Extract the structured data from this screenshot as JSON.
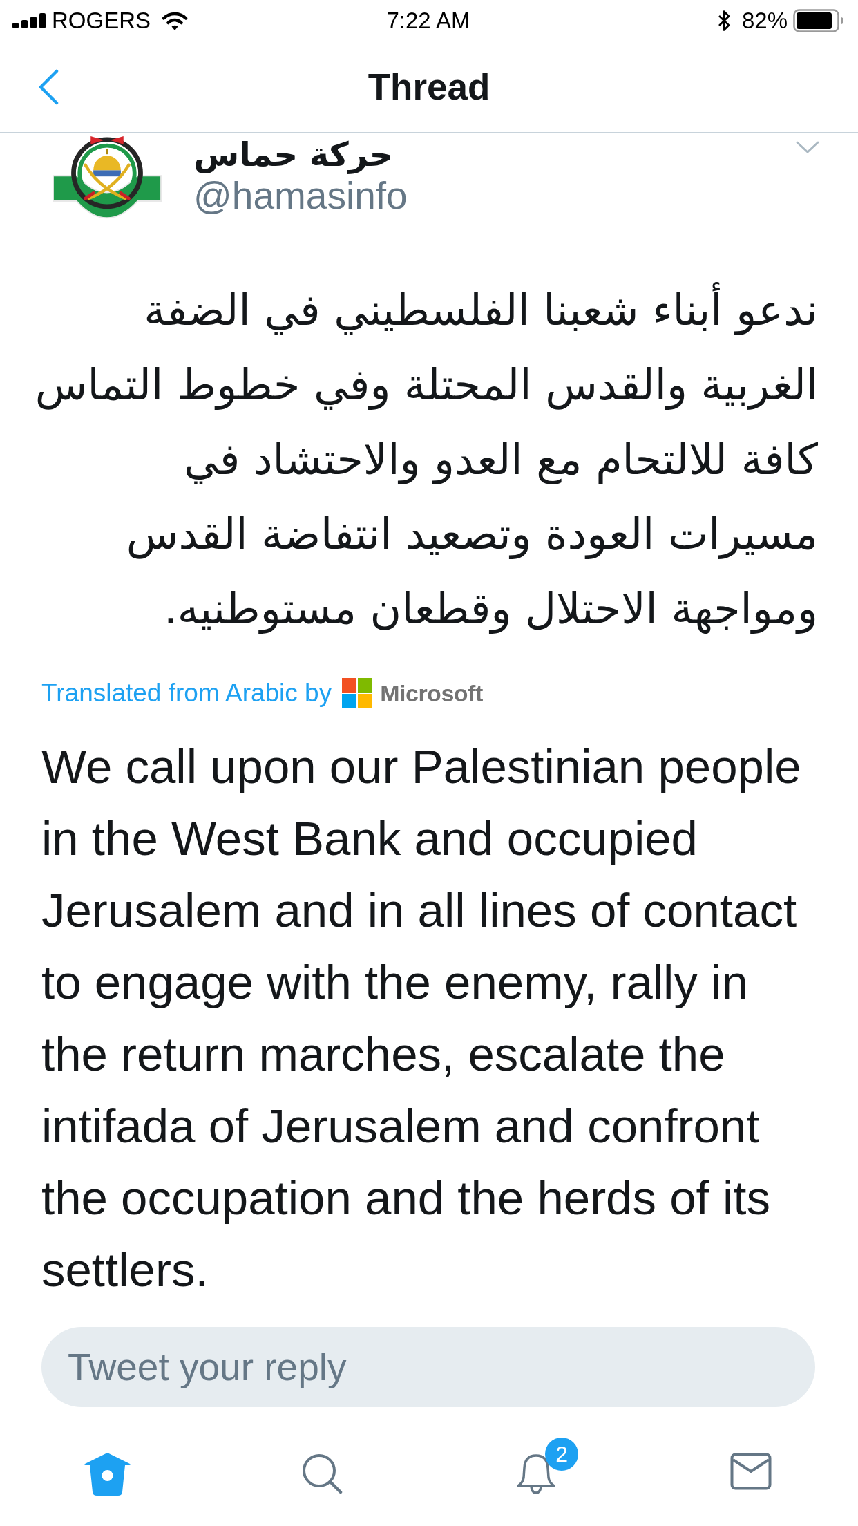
{
  "status_bar": {
    "carrier": "ROGERS",
    "time": "7:22 AM",
    "battery": "82%"
  },
  "nav": {
    "title": "Thread"
  },
  "tweet": {
    "display_name": "حركة حماس",
    "handle": "@hamasinfo",
    "text": "ندعو أبناء شعبنا الفلسطيني في الضفة الغربية والقدس المحتلة وفي خطوط التماس كافة للالتحام مع العدو والاحتشاد في مسيرات العودة وتصعيد انتفاضة القدس ومواجهة الاحتلال وقطعان مستوطنيه.",
    "translation_note": "Translated from Arabic by",
    "translator": "Microsoft",
    "translation": "We call upon our Palestinian people in the West Bank and occupied Jerusalem and in all lines of contact to engage with the enemy, rally in the return marches, escalate the intifada of Jerusalem and confront the occupation and the herds of its settlers."
  },
  "reply": {
    "placeholder": "Tweet your reply"
  },
  "tab_bar": [
    {
      "kind": "home",
      "selected": true
    },
    {
      "kind": "search",
      "selected": false
    },
    {
      "kind": "notifications",
      "selected": false,
      "badge": "2"
    },
    {
      "kind": "messages",
      "selected": false
    }
  ]
}
